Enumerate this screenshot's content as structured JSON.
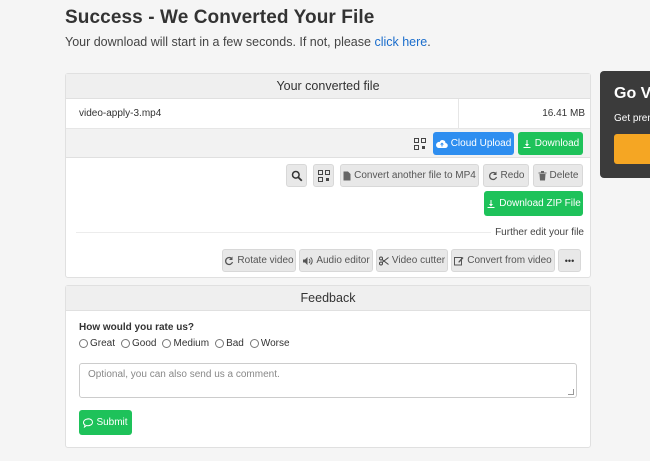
{
  "header": {
    "title": "Success - We Converted Your File",
    "subtitle_prefix": "Your download will start in a few seconds. If not, please ",
    "subtitle_link": "click here",
    "subtitle_suffix": "."
  },
  "converted_card": {
    "title": "Your converted file",
    "file_name": "video-apply-3.mp4",
    "file_size": "16.41 MB",
    "cloud_upload": "Cloud Upload",
    "download": "Download",
    "convert_another": "Convert another file to MP4",
    "redo": "Redo",
    "delete": "Delete",
    "download_zip": "Download ZIP File",
    "further_edit": "Further edit your file",
    "rotate": "Rotate video",
    "audio_editor": "Audio editor",
    "video_cutter": "Video cutter",
    "convert_from_video": "Convert from video",
    "more": "•••"
  },
  "feedback": {
    "title": "Feedback",
    "question": "How would you rate us?",
    "options": [
      "Great",
      "Good",
      "Medium",
      "Bad",
      "Worse"
    ],
    "comment_placeholder": "Optional, you can also send us a comment.",
    "submit": "Submit"
  },
  "promo": {
    "title": "Go V",
    "text": "Get pren"
  },
  "colors": {
    "accent_blue": "#2e8ef0",
    "accent_green": "#1ec25a",
    "link": "#1a6dcc",
    "promo_bg": "#3b3b3b",
    "promo_button": "#f5a623"
  },
  "icons": [
    "qr-icon",
    "cloud-upload-icon",
    "download-icon",
    "search-icon",
    "file-icon",
    "redo-icon",
    "trash-icon",
    "rotate-icon",
    "audio-icon",
    "scissors-icon",
    "edit-icon",
    "ellipsis-icon",
    "comment-icon"
  ]
}
